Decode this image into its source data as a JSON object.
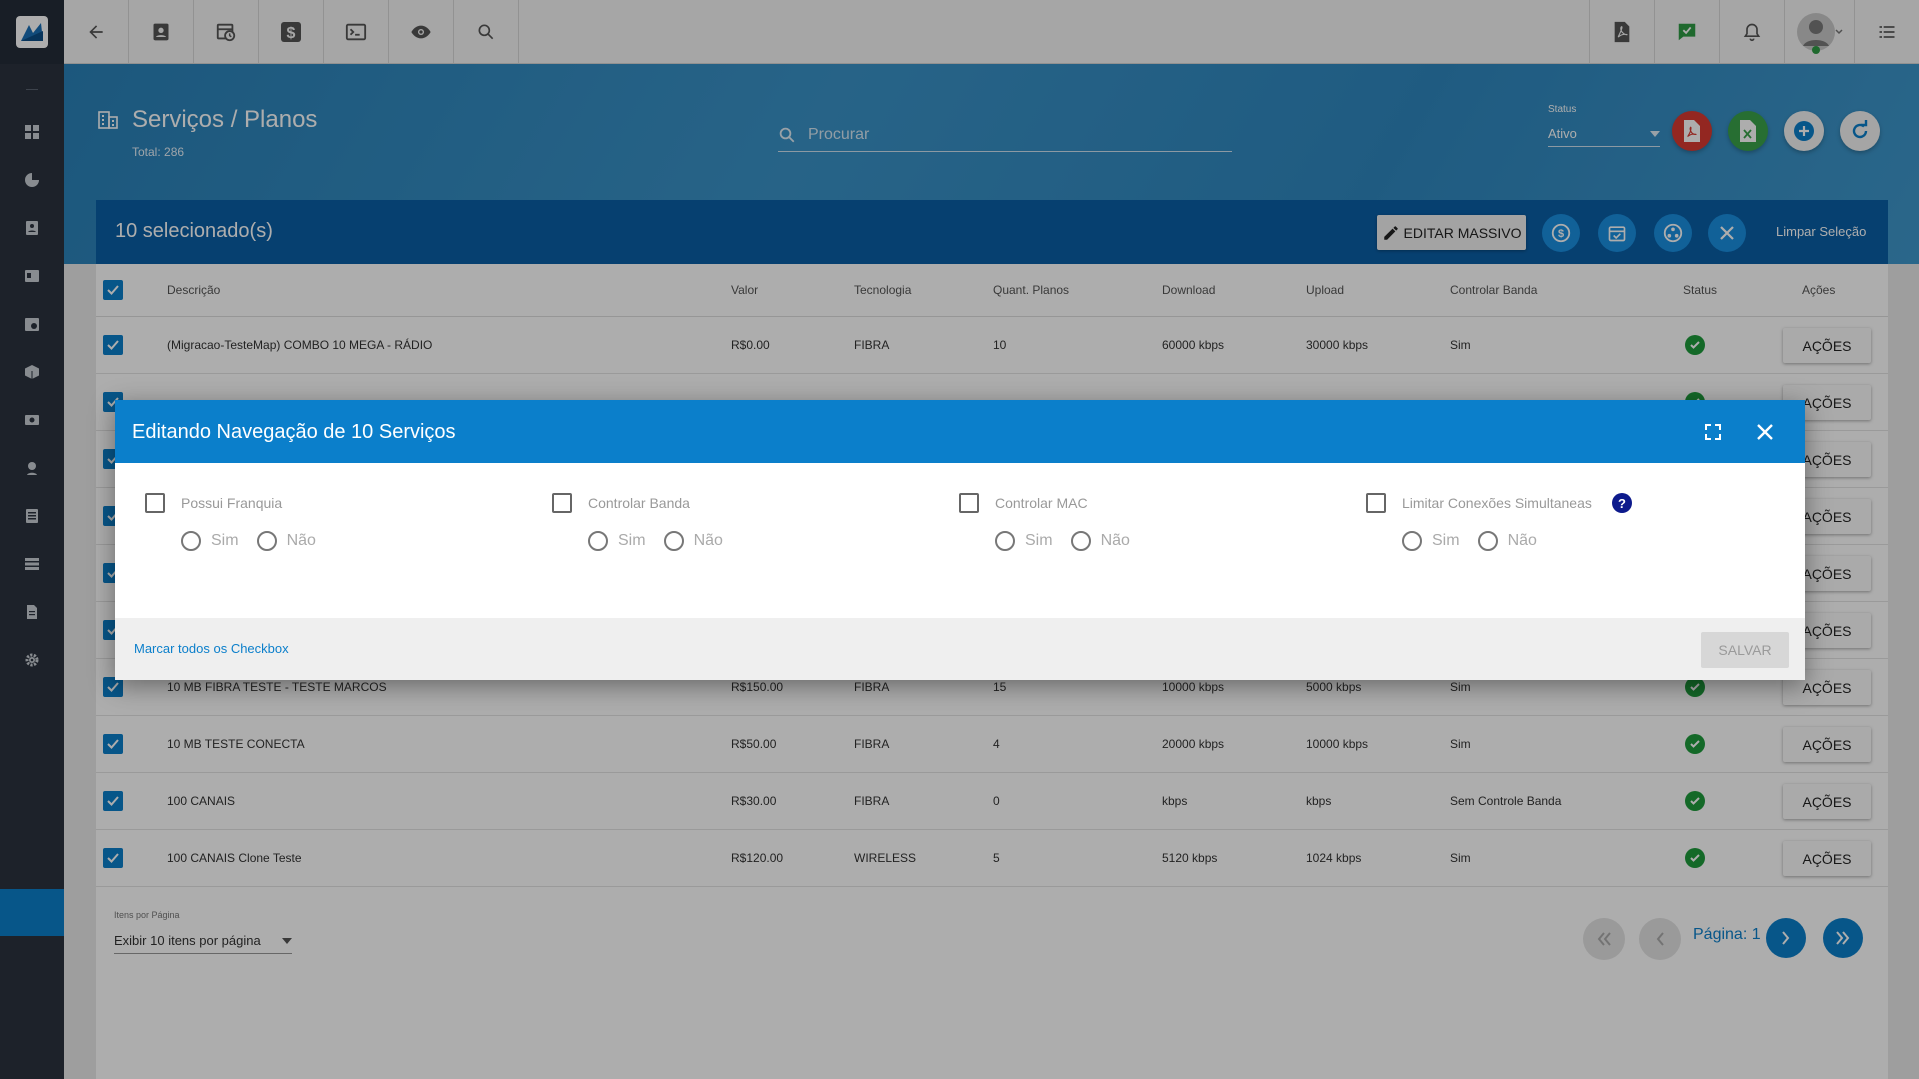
{
  "page": {
    "title": "Serviços / Planos",
    "total": "Total: 286",
    "search_placeholder": "Procurar",
    "status_label": "Status",
    "status_value": "Ativo"
  },
  "selection": {
    "count": "10 selecionado(s)",
    "edit_massivo": "EDITAR MASSIVO",
    "clear": "Limpar Seleção"
  },
  "table": {
    "headers": [
      "Descrição",
      "Valor",
      "Tecnologia",
      "Quant. Planos",
      "Download",
      "Upload",
      "Controlar Banda",
      "Status",
      "Ações"
    ],
    "action_label": "AÇÕES",
    "rows": [
      {
        "descricao": "(Migracao-TesteMap) COMBO 10 MEGA - RÁDIO",
        "valor": "R$0.00",
        "tecnologia": "FIBRA",
        "quant": "10",
        "download": "60000 kbps",
        "upload": "30000 kbps",
        "banda": "Sim"
      },
      {
        "descricao": "",
        "valor": "",
        "tecnologia": "",
        "quant": "",
        "download": "",
        "upload": "",
        "banda": ""
      },
      {
        "descricao": "",
        "valor": "",
        "tecnologia": "",
        "quant": "",
        "download": "",
        "upload": "",
        "banda": ""
      },
      {
        "descricao": "",
        "valor": "",
        "tecnologia": "",
        "quant": "",
        "download": "",
        "upload": "",
        "banda": ""
      },
      {
        "descricao": "",
        "valor": "",
        "tecnologia": "",
        "quant": "",
        "download": "",
        "upload": "",
        "banda": ""
      },
      {
        "descricao": "",
        "valor": "",
        "tecnologia": "",
        "quant": "",
        "download": "",
        "upload": "",
        "banda": ""
      },
      {
        "descricao": "10 MB FIBRA TESTE - TESTE MARCOS",
        "valor": "R$150.00",
        "tecnologia": "FIBRA",
        "quant": "15",
        "download": "10000 kbps",
        "upload": "5000 kbps",
        "banda": "Sim"
      },
      {
        "descricao": "10 MB TESTE CONECTA",
        "valor": "R$50.00",
        "tecnologia": "FIBRA",
        "quant": "4",
        "download": "20000 kbps",
        "upload": "10000 kbps",
        "banda": "Sim"
      },
      {
        "descricao": "100 CANAIS",
        "valor": "R$30.00",
        "tecnologia": "FIBRA",
        "quant": "0",
        "download": "kbps",
        "upload": "kbps",
        "banda": "Sem Controle Banda"
      },
      {
        "descricao": "100 CANAIS Clone Teste",
        "valor": "R$120.00",
        "tecnologia": "WIRELESS",
        "quant": "5",
        "download": "5120 kbps",
        "upload": "1024 kbps",
        "banda": "Sim"
      }
    ]
  },
  "pagination": {
    "ipp_label": "Itens por Página",
    "ipp_value": "Exibir 10 itens por página",
    "page_label": "Página: 1"
  },
  "modal": {
    "title": "Editando Navegação de 10 Serviços",
    "options": [
      {
        "label": "Possui Franquia",
        "yes": "Sim",
        "no": "Não"
      },
      {
        "label": "Controlar Banda",
        "yes": "Sim",
        "no": "Não"
      },
      {
        "label": "Controlar MAC",
        "yes": "Sim",
        "no": "Não"
      },
      {
        "label": "Limitar Conexões Simultaneas",
        "yes": "Sim",
        "no": "Não"
      }
    ],
    "mark_all": "Marcar todos os Checkbox",
    "save": "SALVAR"
  },
  "colors": {
    "primary": "#0b7fcb",
    "selection_bar": "#0a5fa6",
    "sidebar": "#2b333e",
    "pdf": "#d93a32",
    "excel": "#3aa34a",
    "status_ok": "#1e9b3c"
  }
}
